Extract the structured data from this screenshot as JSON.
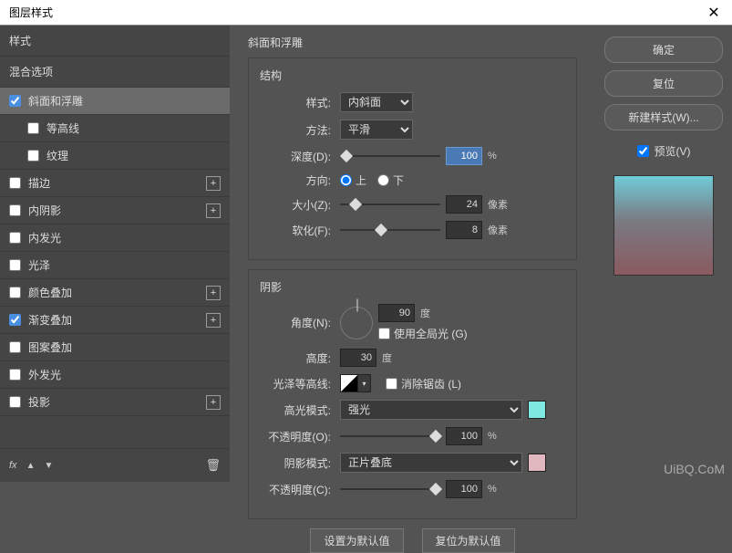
{
  "titlebar": {
    "title": "图层样式",
    "close": "✕"
  },
  "left": {
    "styles_header": "样式",
    "blend_options": "混合选项",
    "items": [
      {
        "label": "斜面和浮雕",
        "checked": true,
        "selected": true,
        "plus": false,
        "indent": false
      },
      {
        "label": "等高线",
        "checked": false,
        "selected": false,
        "plus": false,
        "indent": true
      },
      {
        "label": "纹理",
        "checked": false,
        "selected": false,
        "plus": false,
        "indent": true
      },
      {
        "label": "描边",
        "checked": false,
        "selected": false,
        "plus": true,
        "indent": false
      },
      {
        "label": "内阴影",
        "checked": false,
        "selected": false,
        "plus": true,
        "indent": false
      },
      {
        "label": "内发光",
        "checked": false,
        "selected": false,
        "plus": false,
        "indent": false
      },
      {
        "label": "光泽",
        "checked": false,
        "selected": false,
        "plus": false,
        "indent": false
      },
      {
        "label": "颜色叠加",
        "checked": false,
        "selected": false,
        "plus": true,
        "indent": false
      },
      {
        "label": "渐变叠加",
        "checked": true,
        "selected": false,
        "plus": true,
        "indent": false
      },
      {
        "label": "图案叠加",
        "checked": false,
        "selected": false,
        "plus": false,
        "indent": false
      },
      {
        "label": "外发光",
        "checked": false,
        "selected": false,
        "plus": false,
        "indent": false
      },
      {
        "label": "投影",
        "checked": false,
        "selected": false,
        "plus": true,
        "indent": false
      }
    ],
    "footer_fx": "fx"
  },
  "center": {
    "title": "斜面和浮雕",
    "structure": {
      "title": "结构",
      "style_label": "样式:",
      "style_value": "内斜面",
      "method_label": "方法:",
      "method_value": "平滑",
      "depth_label": "深度(D):",
      "depth_value": "100",
      "depth_unit": "%",
      "direction_label": "方向:",
      "dir_up": "上",
      "dir_down": "下",
      "size_label": "大小(Z):",
      "size_value": "24",
      "size_unit": "像素",
      "soften_label": "软化(F):",
      "soften_value": "8",
      "soften_unit": "像素"
    },
    "shading": {
      "title": "阴影",
      "angle_label": "角度(N):",
      "angle_value": "90",
      "angle_unit": "度",
      "global_light": "使用全局光 (G)",
      "altitude_label": "高度:",
      "altitude_value": "30",
      "altitude_unit": "度",
      "gloss_label": "光泽等高线:",
      "antialias": "消除锯齿 (L)",
      "highlight_mode_label": "高光模式:",
      "highlight_mode_value": "强光",
      "highlight_color": "#7fe8e0",
      "highlight_opacity_label": "不透明度(O):",
      "highlight_opacity_value": "100",
      "highlight_opacity_unit": "%",
      "shadow_mode_label": "阴影模式:",
      "shadow_mode_value": "正片叠底",
      "shadow_color": "#e1b8bf",
      "shadow_opacity_label": "不透明度(C):",
      "shadow_opacity_value": "100",
      "shadow_opacity_unit": "%"
    },
    "default_set": "设置为默认值",
    "default_reset": "复位为默认值"
  },
  "right": {
    "ok": "确定",
    "cancel": "复位",
    "new_style": "新建样式(W)...",
    "preview": "预览(V)"
  },
  "watermark": "UiBQ.CoM"
}
